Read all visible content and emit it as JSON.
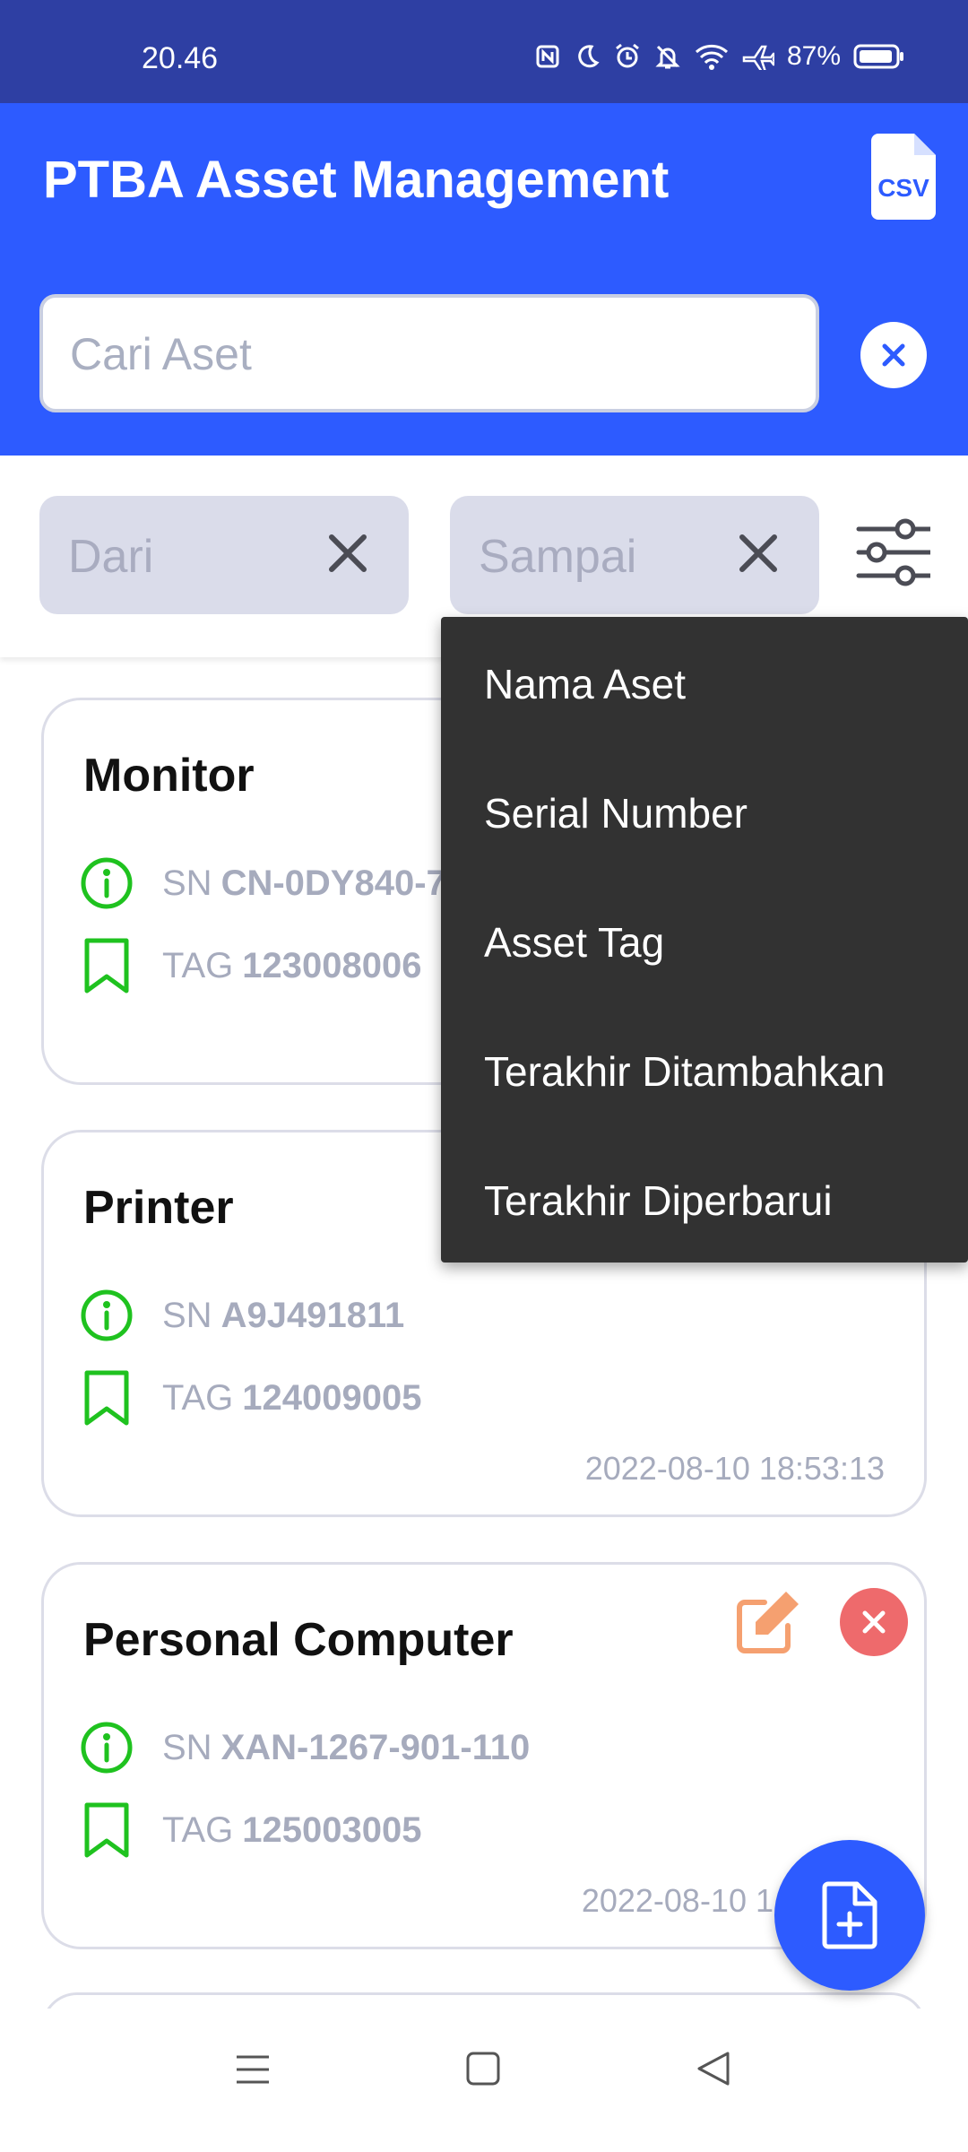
{
  "status_bar": {
    "time": "20.46",
    "battery": "87%",
    "icons": [
      "nfc-icon",
      "moon-icon",
      "alarm-icon",
      "mute-icon",
      "wifi-icon",
      "airplane-icon",
      "battery-icon"
    ]
  },
  "header": {
    "title": "PTBA Asset Management",
    "csv_icon": "csv-file-icon",
    "csv_label": "CSV"
  },
  "search": {
    "placeholder": "Cari Aset",
    "value": ""
  },
  "filters": {
    "from_placeholder": "Dari",
    "to_placeholder": "Sampai"
  },
  "sort_menu": {
    "items": [
      "Nama Aset",
      "Serial Number",
      "Asset Tag",
      "Terakhir Ditambahkan",
      "Terakhir Diperbarui"
    ]
  },
  "assets": [
    {
      "name": "Monitor",
      "sn_label": "SN",
      "sn": "CN-0DY840-7",
      "tag_label": "TAG",
      "tag": "123008006",
      "date": ""
    },
    {
      "name": "Printer",
      "sn_label": "SN",
      "sn": "A9J491811",
      "tag_label": "TAG",
      "tag": "124009005",
      "date": "2022-08-10 18:53:13"
    },
    {
      "name": "Personal Computer",
      "sn_label": "SN",
      "sn": "XAN-1267-901-110",
      "tag_label": "TAG",
      "tag": "125003005",
      "date": "2022-08-10 1"
    }
  ],
  "colors": {
    "status_bar": "#2e3fa3",
    "primary": "#2d5bff",
    "icon_green": "#1fc21f",
    "edit_orange": "#f5a070",
    "delete_red": "#ee6a6c",
    "menu_bg": "#323232"
  }
}
